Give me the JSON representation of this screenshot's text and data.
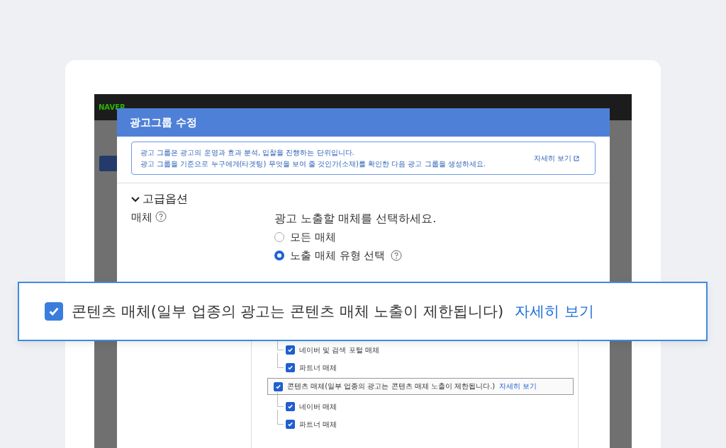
{
  "app_header": {
    "logo": "NAVER"
  },
  "modal": {
    "title": "광고그룹 수정",
    "notice": {
      "lines": [
        "광고 그룹은 광고의 운영과 효과 분석, 입찰을 진행하는 단위입니다.",
        "광고 그룹을 기준으로 누구에게(타겟팅) 무엇을 보여 줄 것인가(소재)를 확인한 다음 광고 그룹을 생성하세요."
      ],
      "link": "자세히 보기"
    },
    "section": {
      "title": "고급옵션",
      "expanded": true
    },
    "field_label": "매체",
    "prompt": "광고 노출할 매체를 선택하세요.",
    "radios": [
      {
        "label": "모든 매체",
        "selected": false,
        "help": false
      },
      {
        "label": "노출 매체 유형 선택",
        "selected": true,
        "help": true
      }
    ],
    "media_tree": [
      {
        "children": [
          {
            "label": "네이버 및 검색 포털 매체",
            "checked": true
          },
          {
            "label": "파트너 매체",
            "checked": true
          }
        ]
      },
      {
        "label": "콘텐츠 매체(일부 업종의 광고는 콘텐츠 매체 노출이 제한됩니다.)",
        "link": "자세히 보기",
        "checked": true,
        "highlighted": true,
        "children": [
          {
            "label": "네이버 매체",
            "checked": true
          },
          {
            "label": "파트너 매체",
            "checked": true
          }
        ]
      }
    ]
  },
  "callout": {
    "checked": true,
    "label": "콘텐츠 매체(일부 업종의 광고는 콘텐츠 매체 노출이 제한됩니다)",
    "link": "자세히 보기"
  }
}
